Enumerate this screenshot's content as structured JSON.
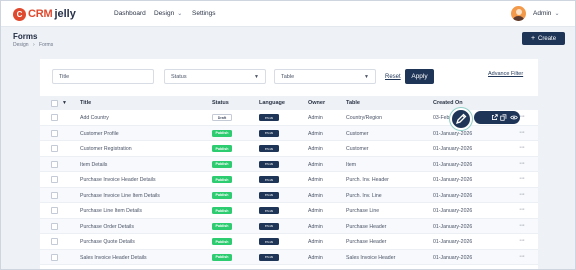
{
  "brand": {
    "badge": "C",
    "name_part1": "CRM",
    "name_part2": "jelly"
  },
  "nav": {
    "dashboard": "Dashboard",
    "design": "Design",
    "settings": "Settings"
  },
  "user": {
    "name": "Admin"
  },
  "page": {
    "title": "Forms",
    "breadcrumb": [
      "Design",
      "Forms"
    ],
    "create_label": "Create"
  },
  "filters": {
    "title_placeholder": "Title",
    "status_placeholder": "Status",
    "table_placeholder": "Table",
    "reset_label": "Reset",
    "apply_label": "Apply",
    "advance_label": "Advance Filter"
  },
  "table": {
    "columns": {
      "title": "Title",
      "status": "Status",
      "language": "Language",
      "owner": "Owner",
      "table": "Table",
      "created_on": "Created On"
    },
    "rows": [
      {
        "title": "Add Country",
        "status": "Draft",
        "language": "en-us",
        "owner": "Admin",
        "table": "Country/Region",
        "created": "03-Feb"
      },
      {
        "title": "Customer Profile",
        "status": "Publish",
        "language": "en-us",
        "owner": "Admin",
        "table": "Customer",
        "created": "01-January-2026"
      },
      {
        "title": "Customer Registration",
        "status": "Publish",
        "language": "en-us",
        "owner": "Admin",
        "table": "Customer",
        "created": "01-January-2026"
      },
      {
        "title": "Item Details",
        "status": "Publish",
        "language": "en-us",
        "owner": "Admin",
        "table": "Item",
        "created": "01-January-2026"
      },
      {
        "title": "Purchase Invoice Header Details",
        "status": "Publish",
        "language": "en-us",
        "owner": "Admin",
        "table": "Purch. Inv. Header",
        "created": "01-January-2026"
      },
      {
        "title": "Purchase Invoice Line Item Details",
        "status": "Publish",
        "language": "en-us",
        "owner": "Admin",
        "table": "Purch. Inv. Line",
        "created": "01-January-2026"
      },
      {
        "title": "Purchase Line Item Details",
        "status": "Publish",
        "language": "en-us",
        "owner": "Admin",
        "table": "Purchase Line",
        "created": "01-January-2026"
      },
      {
        "title": "Purchase Order Details",
        "status": "Publish",
        "language": "en-us",
        "owner": "Admin",
        "table": "Purchase Header",
        "created": "01-January-2026"
      },
      {
        "title": "Purchase Quote Details",
        "status": "Publish",
        "language": "en-us",
        "owner": "Admin",
        "table": "Purchase Header",
        "created": "01-January-2026"
      },
      {
        "title": "Sales Invoice Header Details",
        "status": "Publish",
        "language": "en-us",
        "owner": "Admin",
        "table": "Sales Invoice Header",
        "created": "01-January-2026"
      }
    ]
  },
  "icons": {
    "row_actions": [
      "pencil-icon",
      "external-link-icon",
      "copy-icon",
      "eye-icon"
    ],
    "more": "more-dots-icon"
  },
  "colors": {
    "brand": "#e0492e",
    "primary": "#1f3557",
    "publish": "#2ecc71",
    "accent_ring": "#8fd0c8"
  }
}
